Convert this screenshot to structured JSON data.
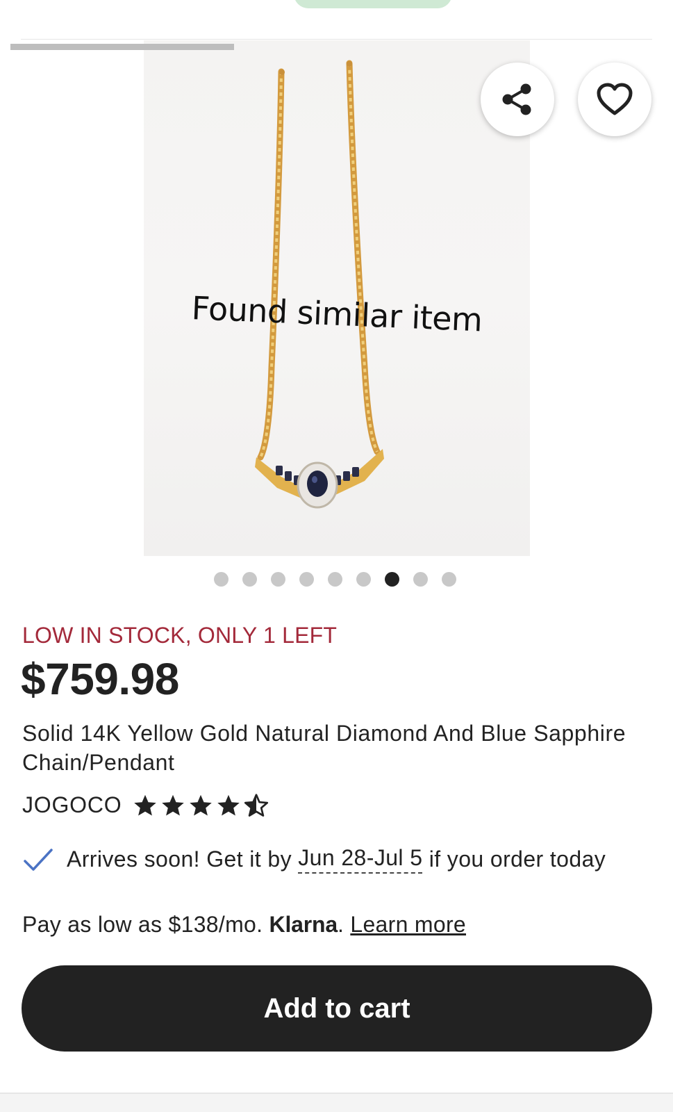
{
  "gallery": {
    "overlay_text": "Found similar item",
    "progress": 0.33,
    "total_images": 9,
    "active_index": 6
  },
  "actions": {
    "share_icon": "share-icon",
    "favorite_icon": "heart-outline-icon"
  },
  "product": {
    "stock_notice": "LOW IN STOCK, ONLY 1 LEFT",
    "price": "$759.98",
    "title": "Solid 14K Yellow Gold Natural Diamond And Blue Sapphire Chain/Pendant",
    "shop": "JOGOCO",
    "rating": 4.5
  },
  "delivery": {
    "icon": "checkmark-icon",
    "prefix": "Arrives soon! Get it by",
    "dates": "Jun 28-Jul 5",
    "suffix": "if you order today"
  },
  "payment": {
    "prefix": "Pay as low as $138/mo.",
    "brand": "Klarna",
    "dot": ".",
    "learn_more": "Learn more"
  },
  "cart": {
    "label": "Add to cart"
  },
  "colors": {
    "stock": "#a3293a",
    "button": "#222222",
    "check": "#4b73c4",
    "pill": "#cfe9d4"
  }
}
